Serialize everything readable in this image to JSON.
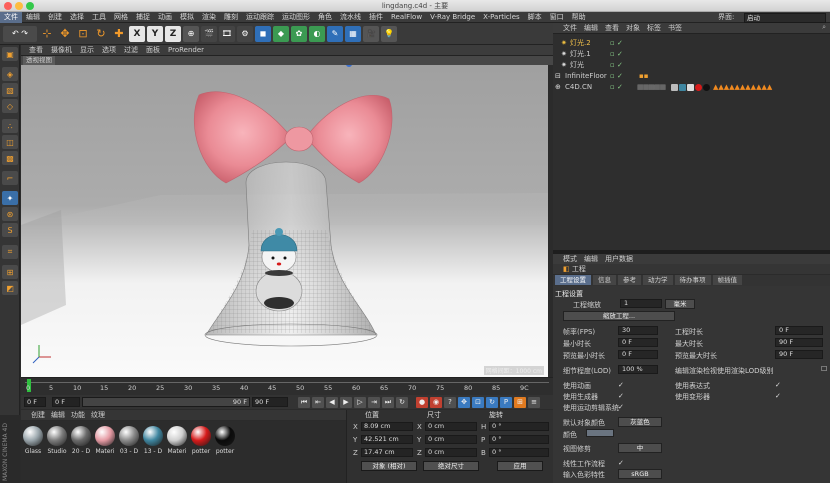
{
  "window": {
    "title": "lingdang.c4d - 主要"
  },
  "menubar": {
    "items": [
      "文件",
      "编辑",
      "创建",
      "选择",
      "工具",
      "网格",
      "捕捉",
      "动画",
      "模拟",
      "渲染",
      "雕刻",
      "运动跟踪",
      "运动图形",
      "角色",
      "流水线",
      "插件",
      "RealFlow",
      "V-Ray Bridge",
      "X-Particles",
      "脚本",
      "窗口",
      "帮助"
    ],
    "layout_label": "界面:",
    "layout_value": "启动"
  },
  "toolbar": {
    "axis_x": "X",
    "axis_y": "Y",
    "axis_z": "Z"
  },
  "viewport": {
    "menu": [
      "查看",
      "摄像机",
      "显示",
      "选项",
      "过滤",
      "面板",
      "ProRender"
    ],
    "tab": "透视视图",
    "status": "网格间距：1000 cm"
  },
  "timeline": {
    "ticks": [
      "0",
      "5",
      "10",
      "15",
      "20",
      "25",
      "30",
      "35",
      "40",
      "45",
      "50",
      "55",
      "60",
      "65",
      "70",
      "75",
      "80",
      "85",
      "9C"
    ],
    "start_field": "0 F",
    "current_field": "0 F",
    "end_field": "90 F",
    "max_field": "90 F"
  },
  "materials": {
    "menu": [
      "创建",
      "编辑",
      "功能",
      "纹理"
    ],
    "items": [
      {
        "label": "Glass",
        "color": "#9aa6ac"
      },
      {
        "label": "Studio",
        "color": "#7c7c7c"
      },
      {
        "label": "20 - D",
        "color": "#6a6a6a"
      },
      {
        "label": "Materi",
        "color": "#e59aa3"
      },
      {
        "label": "03 - D",
        "color": "#8a8a8a"
      },
      {
        "label": "13 - D",
        "color": "#3f86a0"
      },
      {
        "label": "Materi",
        "color": "#d0d0d0"
      },
      {
        "label": "potter",
        "color": "#d61a1a"
      },
      {
        "label": "potter",
        "color": "#0a0a0a"
      }
    ],
    "brand": "MAXON CINEMA 4D"
  },
  "coordinates": {
    "headers": {
      "position": "位置",
      "size": "尺寸",
      "rotation": "旋转"
    },
    "rows": [
      {
        "axis": "X",
        "pos": "8.09 cm",
        "size": "0 cm",
        "rot_axis": "H",
        "rot": "0 °"
      },
      {
        "axis": "Y",
        "pos": "42.521 cm",
        "size": "0 cm",
        "rot_axis": "P",
        "rot": "0 °"
      },
      {
        "axis": "Z",
        "pos": "17.47 cm",
        "size": "0 cm",
        "rot_axis": "B",
        "rot": "0 °"
      }
    ],
    "mode_select": "对象 (相对)",
    "size_select": "绝对尺寸",
    "apply_button": "应用"
  },
  "object_manager": {
    "menu": [
      "文件",
      "编辑",
      "查看",
      "对象",
      "标签",
      "书签"
    ],
    "objects": [
      {
        "name": "灯光.2",
        "highlight": true
      },
      {
        "name": "灯光.1",
        "highlight": false
      },
      {
        "name": "灯光",
        "highlight": false
      },
      {
        "name": "InfiniteFloor",
        "highlight": false
      },
      {
        "name": "C4D.CN",
        "highlight": false
      }
    ]
  },
  "attributes": {
    "menu": [
      "模式",
      "编辑",
      "用户数据"
    ],
    "title": "工程",
    "tabs": [
      "工程设置",
      "信息",
      "参考",
      "动力学",
      "待办事项",
      "帧插值"
    ],
    "section": "工程设置",
    "project_scale_label": "工程缩放",
    "project_scale_value": "1",
    "project_scale_unit": "毫米",
    "scale_project_button": "缩放工程...",
    "fps_label": "帧率(FPS)",
    "fps_value": "30",
    "project_time_label": "工程时长",
    "project_time_value": "0 F",
    "min_time_label": "最小时长",
    "min_time_value": "0 F",
    "max_time_label": "最大时长",
    "max_time_value": "90 F",
    "preview_min_label": "预览最小时长",
    "preview_min_value": "0 F",
    "preview_max_label": "预览最大时长",
    "preview_max_value": "90 F",
    "lod_label": "细节程度(LOD)",
    "lod_value": "100 %",
    "lod_render_label": "编辑渲染检视使用渲染LOD级别",
    "use_anim_label": "使用动画",
    "use_expr_label": "使用表达式",
    "use_gen_label": "使用生成器",
    "use_deform_label": "使用变形器",
    "use_motion_label": "使用运动剪辑系统",
    "default_color_label": "默认对象颜色",
    "default_color_value": "灰蓝色",
    "color_label": "颜色",
    "view_clip_label": "视图修剪",
    "view_clip_value": "中",
    "linear_workflow_label": "线性工作流程",
    "input_color_label": "输入色彩特性",
    "input_color_value": "sRGB"
  }
}
